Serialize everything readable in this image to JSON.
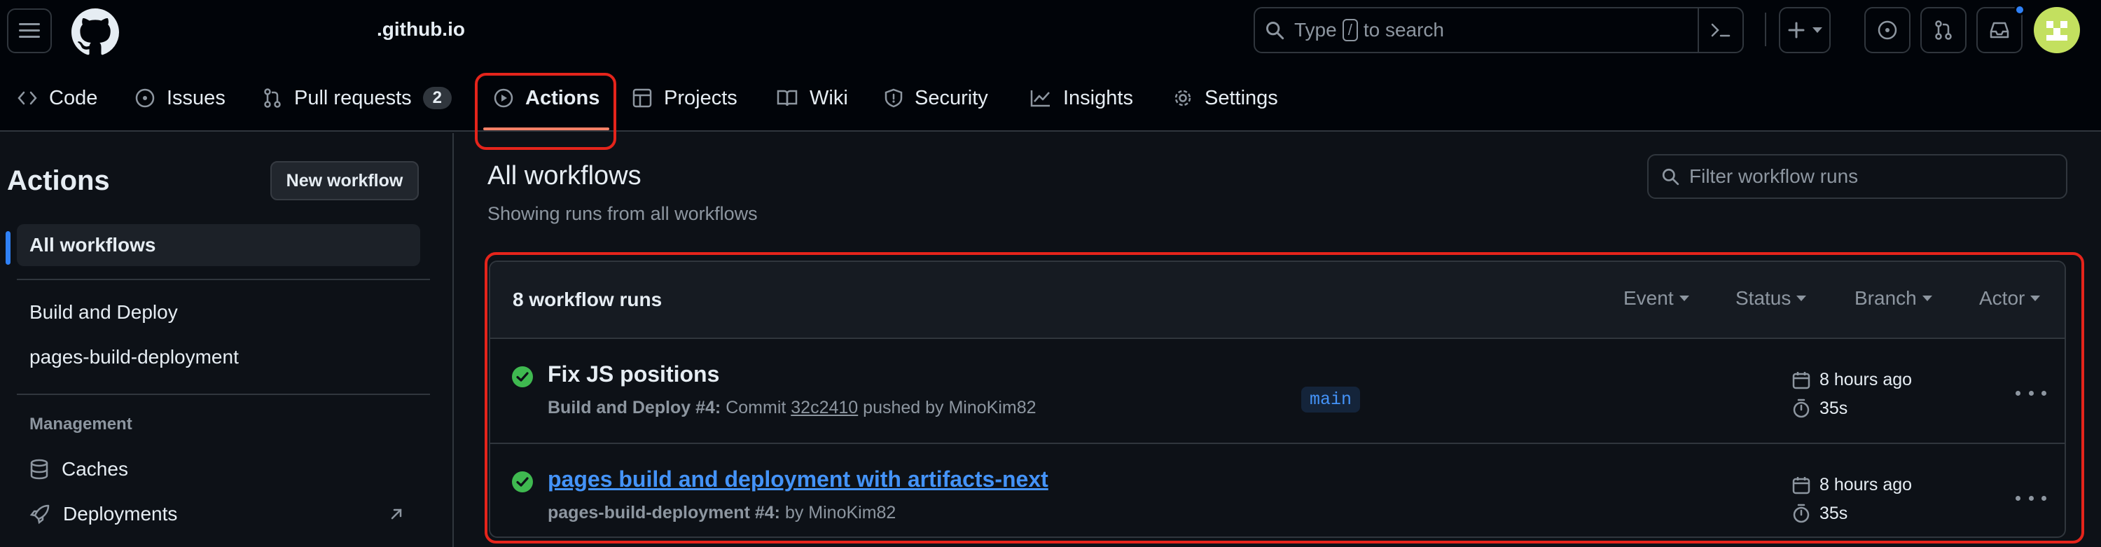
{
  "header": {
    "repo_name": ".github.io",
    "search": {
      "prefix": "Type",
      "key": "/",
      "suffix": "to search"
    }
  },
  "tabs": [
    {
      "label": "Code",
      "icon": "code-icon"
    },
    {
      "label": "Issues",
      "icon": "issue-opened-icon"
    },
    {
      "label": "Pull requests",
      "icon": "git-pull-request-icon",
      "count": "2"
    },
    {
      "label": "Actions",
      "icon": "play-icon",
      "selected": true
    },
    {
      "label": "Projects",
      "icon": "table-icon"
    },
    {
      "label": "Wiki",
      "icon": "book-icon"
    },
    {
      "label": "Security",
      "icon": "shield-icon"
    },
    {
      "label": "Insights",
      "icon": "graph-icon"
    },
    {
      "label": "Settings",
      "icon": "gear-icon"
    }
  ],
  "sidebar": {
    "title": "Actions",
    "new_workflow": "New workflow",
    "all_workflows": "All workflows",
    "workflows": [
      "Build and Deploy",
      "pages-build-deployment"
    ],
    "management_label": "Management",
    "management": [
      {
        "label": "Caches",
        "icon": "database-icon"
      },
      {
        "label": "Deployments",
        "icon": "rocket-icon"
      }
    ]
  },
  "main": {
    "title": "All workflows",
    "subtitle": "Showing runs from all workflows",
    "filter_placeholder": "Filter workflow runs",
    "runs_count": "8 workflow runs",
    "filters": [
      "Event",
      "Status",
      "Branch",
      "Actor"
    ],
    "runs": [
      {
        "title": "Fix JS positions",
        "workflow": "Build and Deploy #4:",
        "meta_mid": "Commit",
        "commit": "32c2410",
        "meta_end": "pushed by MinoKim82",
        "branch": "main",
        "time": "8 hours ago",
        "duration": "35s"
      },
      {
        "title": "pages build and deployment with artifacts-next",
        "workflow": "pages-build-deployment #4:",
        "meta_end": "by MinoKim82",
        "time": "8 hours ago",
        "duration": "35s"
      }
    ]
  },
  "colors": {
    "accent": "#2f81f7",
    "success": "#3fb950",
    "highlight": "#e5241b",
    "tab_underline": "#f78166"
  }
}
